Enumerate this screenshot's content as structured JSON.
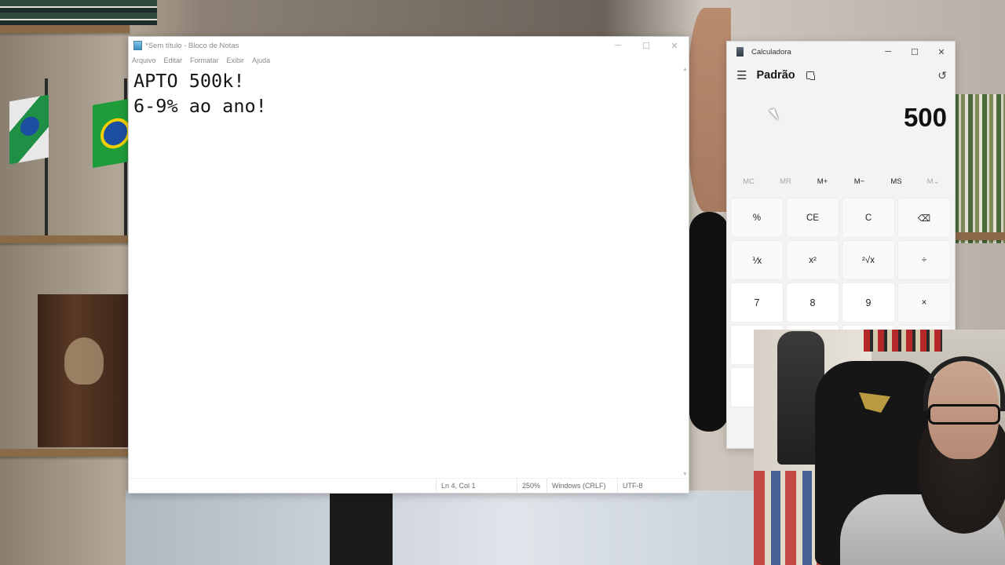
{
  "notepad": {
    "title": "*Sem título - Bloco de Notas",
    "menu": [
      "Arquivo",
      "Editar",
      "Formatar",
      "Exibir",
      "Ajuda"
    ],
    "content": "APTO 500k!\n6-9% ao ano!",
    "status": {
      "position": "Ln 4, Col 1",
      "zoom": "250%",
      "line_ending": "Windows (CRLF)",
      "encoding": "UTF-8"
    }
  },
  "window_controls": {
    "minimize": "─",
    "maximize": "☐",
    "close": "✕"
  },
  "calculator": {
    "title": "Calculadora",
    "mode": "Padrão",
    "display": "500",
    "memory": [
      "MC",
      "MR",
      "M+",
      "M−",
      "MS",
      "M⌄"
    ],
    "keys": {
      "percent": "%",
      "ce": "CE",
      "c": "C",
      "backspace": "⌫",
      "reciprocal": "⅟x",
      "square": "x²",
      "sqrt": "²√x",
      "divide": "÷",
      "seven": "7",
      "eight": "8",
      "nine": "9",
      "multiply": "×"
    },
    "icons": {
      "menu": "hamburger-icon",
      "keep_on_top": "keep-on-top-icon",
      "history": "history-icon"
    }
  },
  "colors": {
    "notepad_bg": "#ffffff",
    "calc_bg": "#f3f3f3",
    "calc_key": "#f9f9f9",
    "calc_num_key": "#ffffff"
  }
}
